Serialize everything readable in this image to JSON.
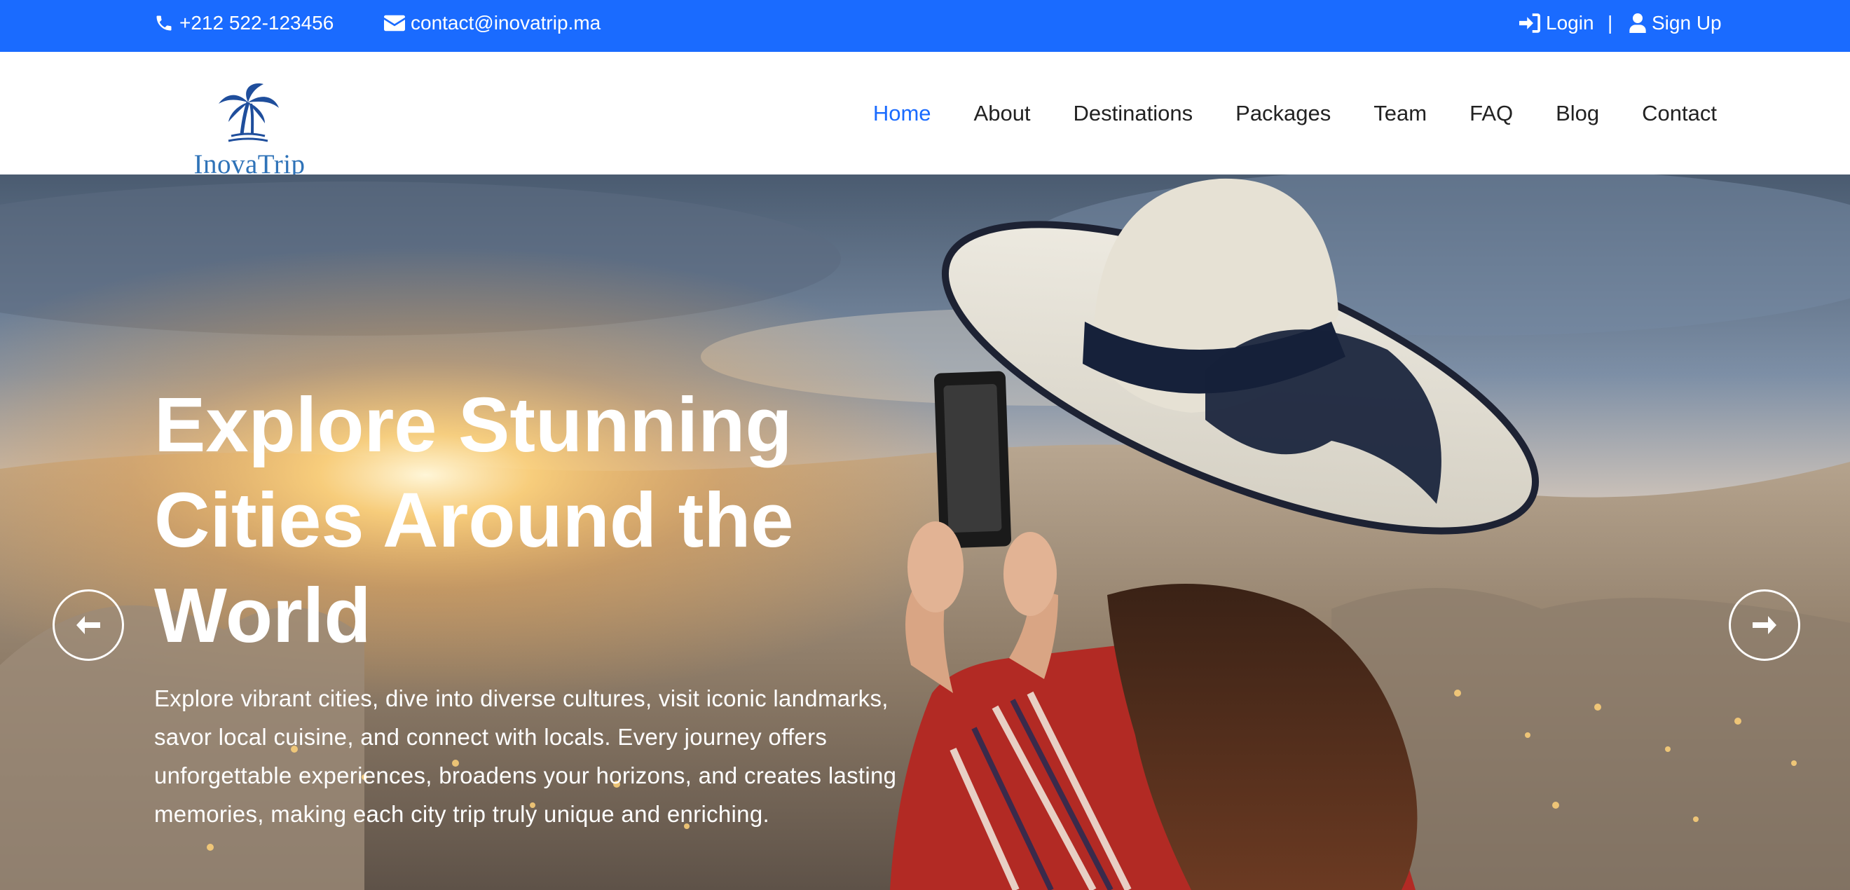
{
  "topbar": {
    "phone": "+212 522-123456",
    "email": "contact@inovatrip.ma",
    "login": "Login",
    "separator": "|",
    "signup": "Sign Up",
    "icons": [
      "phone-icon",
      "envelope-icon",
      "login-icon",
      "user-icon"
    ]
  },
  "brand": {
    "name": "InovaTrip"
  },
  "nav": {
    "items": [
      "Home",
      "About",
      "Destinations",
      "Packages",
      "Team",
      "FAQ",
      "Blog",
      "Contact"
    ],
    "active": "Home"
  },
  "hero": {
    "title": "Explore Stunning Cities Around the World",
    "text": "Explore vibrant cities, dive into diverse cultures, visit iconic landmarks, savor local cuisine, and connect with locals. Every journey offers unforgettable experiences, broadens your horizons, and creates lasting memories, making each city trip truly unique and enriching.",
    "prev_icon": "arrow-left-icon",
    "next_icon": "arrow-right-icon"
  },
  "colors": {
    "topbar": "#1a6bff",
    "active_nav": "#1a6bff",
    "logo": "#2f73b8"
  }
}
